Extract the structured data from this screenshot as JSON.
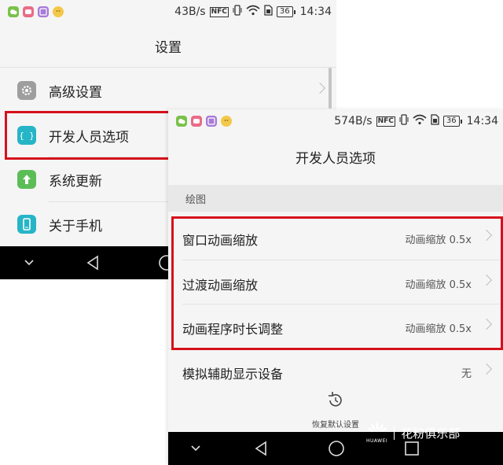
{
  "left_screen": {
    "status": {
      "speed": "43B/s",
      "nfc": "NFC",
      "battery": "36",
      "time": "14:34"
    },
    "title": "设置",
    "items": [
      {
        "label": "高级设置"
      },
      {
        "label": "开发人员选项"
      },
      {
        "label": "系统更新"
      },
      {
        "label": "关于手机"
      }
    ]
  },
  "right_screen": {
    "status": {
      "speed": "574B/s",
      "nfc": "NFC",
      "battery": "36",
      "time": "14:34"
    },
    "title": "开发人员选项",
    "section": "绘图",
    "options": [
      {
        "title": "窗口动画缩放",
        "value": "动画缩放 0.5x"
      },
      {
        "title": "过渡动画缩放",
        "value": "动画缩放 0.5x"
      },
      {
        "title": "动画程序时长调整",
        "value": "动画缩放 0.5x"
      },
      {
        "title": "模拟辅助显示设备",
        "value": "无"
      }
    ],
    "reset_label": "恢复默认设置"
  },
  "watermark": {
    "brand": "HUAWEI",
    "text": "花粉俱乐部"
  },
  "colors": {
    "highlight_red": "#d6101b",
    "background": "#f5f5f5",
    "nav_bar": "#000000"
  }
}
